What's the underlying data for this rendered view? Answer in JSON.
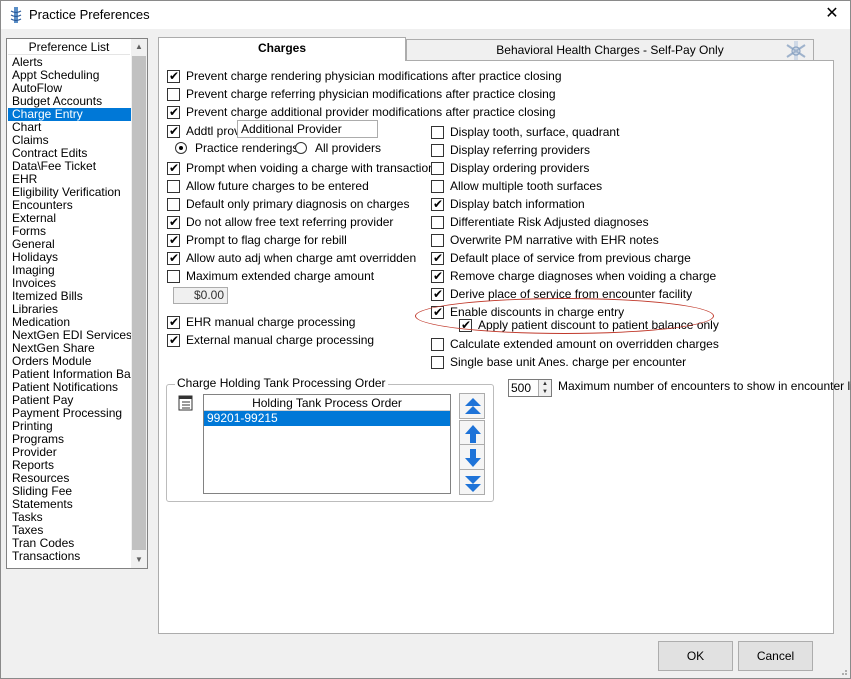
{
  "window": {
    "title": "Practice Preferences",
    "close_glyph": "✕"
  },
  "preference_list": {
    "header": "Preference List",
    "items": [
      "Alerts",
      "Appt Scheduling",
      "AutoFlow",
      "Budget Accounts",
      "Charge Entry",
      "Chart",
      "Claims",
      "Contract Edits",
      "Data\\Fee Ticket",
      "EHR",
      "Eligibility Verification",
      "Encounters",
      "External",
      "Forms",
      "General",
      "Holidays",
      "Imaging",
      "Invoices",
      "Itemized Bills",
      "Libraries",
      "Medication",
      "NextGen EDI Services",
      "NextGen Share",
      "Orders Module",
      "Patient Information Bar",
      "Patient Notifications",
      "Patient Pay",
      "Payment Processing",
      "Printing",
      "Programs",
      "Provider",
      "Reports",
      "Resources",
      "Sliding Fee",
      "Statements",
      "Tasks",
      "Taxes",
      "Tran Codes",
      "Transactions"
    ],
    "selected": "Charge Entry"
  },
  "tabs": {
    "charges": "Charges",
    "behavioral": "Behavioral Health Charges - Self-Pay Only"
  },
  "top_options": [
    {
      "label": "Prevent charge rendering physician modifications after practice closing",
      "checked": true
    },
    {
      "label": "Prevent charge referring physician modifications after practice closing",
      "checked": false
    },
    {
      "label": "Prevent charge additional provider modifications after practice closing",
      "checked": true
    }
  ],
  "addtl_prov": {
    "label": "Addtl prov",
    "checked": true,
    "value": "Additional Provider"
  },
  "radios": {
    "practice": "Practice renderings",
    "all": "All providers",
    "selected": "practice"
  },
  "left_options": [
    {
      "label": "Prompt when voiding a charge with transactions",
      "checked": true
    },
    {
      "label": "Allow future charges to be entered",
      "checked": false
    },
    {
      "label": "Default only primary diagnosis on charges",
      "checked": false
    },
    {
      "label": "Do not allow free text referring provider",
      "checked": true
    },
    {
      "label": "Prompt to flag charge for rebill",
      "checked": true
    },
    {
      "label": "Allow auto adj when charge amt overridden",
      "checked": true
    },
    {
      "label": "Maximum extended charge amount",
      "checked": false
    }
  ],
  "max_amount": "$0.00",
  "left_options_2": [
    {
      "label": "EHR manual charge processing",
      "checked": true
    },
    {
      "label": "External manual charge processing",
      "checked": true
    }
  ],
  "right_options": [
    {
      "label": "Display tooth, surface, quadrant",
      "checked": false
    },
    {
      "label": "Display referring providers",
      "checked": false
    },
    {
      "label": "Display ordering providers",
      "checked": false
    },
    {
      "label": "Allow multiple tooth surfaces",
      "checked": false
    },
    {
      "label": "Display batch information",
      "checked": true
    },
    {
      "label": "Differentiate Risk Adjusted diagnoses",
      "checked": false
    },
    {
      "label": "Overwrite PM narrative with EHR notes",
      "checked": false
    },
    {
      "label": "Default place of service from previous charge",
      "checked": true
    },
    {
      "label": "Remove charge diagnoses when voiding a charge",
      "checked": true
    },
    {
      "label": "Derive place of service from encounter facility",
      "checked": true
    },
    {
      "label": "Enable discounts in charge entry",
      "checked": true
    }
  ],
  "apply_discount": {
    "label": "Apply patient discount to patient balance only",
    "checked": true
  },
  "right_options_2": [
    {
      "label": "Calculate extended amount on overridden charges",
      "checked": false
    },
    {
      "label": "Single base unit Anes. charge per encounter",
      "checked": false
    }
  ],
  "holding_tank": {
    "group_title": "Charge Holding Tank Processing Order",
    "list_header": "Holding Tank Process Order",
    "rows": [
      "99201-99215"
    ]
  },
  "max_encounters": {
    "value": "500",
    "label": "Maximum number of encounters to show in encounter list"
  },
  "buttons": {
    "ok": "OK",
    "cancel": "Cancel"
  },
  "colors": {
    "selection": "#0078d7",
    "highlight_oval": "#c0392b",
    "arrow_blue": "#1e73d8"
  }
}
